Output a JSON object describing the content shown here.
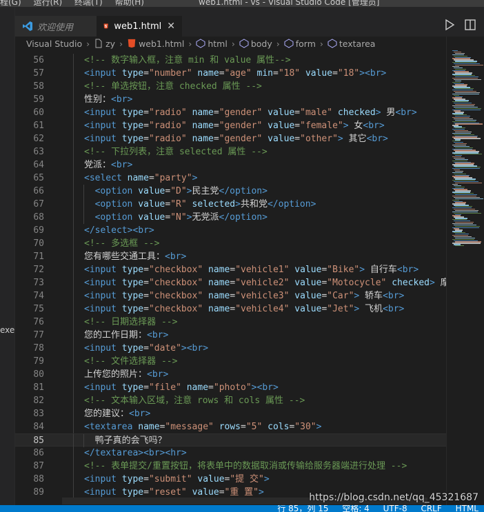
{
  "titlebar": {
    "menu": [
      "程(G)",
      "运行(R)",
      "终端(T)",
      "帮助(H)"
    ],
    "window_title": "web1.html - vs - Visual Studio Code [管理员]"
  },
  "leftpanel": {
    "fragment": "exe"
  },
  "tabs": [
    {
      "label": "欢迎使用",
      "active": false,
      "icon": "vscode-icon"
    },
    {
      "label": "web1.html",
      "active": true,
      "icon": "html5-icon"
    }
  ],
  "breadcrumb": {
    "items": [
      "Visual Studio",
      "zy",
      "web1.html",
      "html",
      "body",
      "form",
      "textarea"
    ]
  },
  "editor": {
    "current_line": 85,
    "lines": [
      {
        "n": 56,
        "indent": 2,
        "tokens": [
          [
            "cmt",
            "<!-- 数字输入框，注意 min 和 value 属性-->"
          ]
        ]
      },
      {
        "n": 57,
        "indent": 2,
        "tokens": [
          [
            "tag",
            "<input "
          ],
          [
            "attr",
            "type"
          ],
          [
            "txt",
            "="
          ],
          [
            "str",
            "\"number\""
          ],
          [
            "txt",
            " "
          ],
          [
            "attr",
            "name"
          ],
          [
            "txt",
            "="
          ],
          [
            "str",
            "\"age\""
          ],
          [
            "txt",
            " "
          ],
          [
            "attr",
            "min"
          ],
          [
            "txt",
            "="
          ],
          [
            "str",
            "\"18\""
          ],
          [
            "txt",
            " "
          ],
          [
            "attr",
            "value"
          ],
          [
            "txt",
            "="
          ],
          [
            "str",
            "\"18\""
          ],
          [
            "tag",
            "><br>"
          ]
        ]
      },
      {
        "n": 58,
        "indent": 2,
        "tokens": [
          [
            "cmt",
            "<!-- 单选按钮，注意 checked 属性 -->"
          ]
        ]
      },
      {
        "n": 59,
        "indent": 2,
        "tokens": [
          [
            "txt",
            "性别："
          ],
          [
            "tag",
            "<br>"
          ]
        ]
      },
      {
        "n": 60,
        "indent": 2,
        "tokens": [
          [
            "tag",
            "<input "
          ],
          [
            "attr",
            "type"
          ],
          [
            "txt",
            "="
          ],
          [
            "str",
            "\"radio\""
          ],
          [
            "txt",
            " "
          ],
          [
            "attr",
            "name"
          ],
          [
            "txt",
            "="
          ],
          [
            "str",
            "\"gender\""
          ],
          [
            "txt",
            " "
          ],
          [
            "attr",
            "value"
          ],
          [
            "txt",
            "="
          ],
          [
            "str",
            "\"male\""
          ],
          [
            "txt",
            " "
          ],
          [
            "attr",
            "checked"
          ],
          [
            "tag",
            ">"
          ],
          [
            "txt",
            " 男"
          ],
          [
            "tag",
            "<br>"
          ]
        ]
      },
      {
        "n": 61,
        "indent": 2,
        "tokens": [
          [
            "tag",
            "<input "
          ],
          [
            "attr",
            "type"
          ],
          [
            "txt",
            "="
          ],
          [
            "str",
            "\"radio\""
          ],
          [
            "txt",
            " "
          ],
          [
            "attr",
            "name"
          ],
          [
            "txt",
            "="
          ],
          [
            "str",
            "\"gender\""
          ],
          [
            "txt",
            " "
          ],
          [
            "attr",
            "value"
          ],
          [
            "txt",
            "="
          ],
          [
            "str",
            "\"female\""
          ],
          [
            "tag",
            ">"
          ],
          [
            "txt",
            " 女"
          ],
          [
            "tag",
            "<br>"
          ]
        ]
      },
      {
        "n": 62,
        "indent": 2,
        "tokens": [
          [
            "tag",
            "<input "
          ],
          [
            "attr",
            "type"
          ],
          [
            "txt",
            "="
          ],
          [
            "str",
            "\"radio\""
          ],
          [
            "txt",
            " "
          ],
          [
            "attr",
            "name"
          ],
          [
            "txt",
            "="
          ],
          [
            "str",
            "\"gender\""
          ],
          [
            "txt",
            " "
          ],
          [
            "attr",
            "value"
          ],
          [
            "txt",
            "="
          ],
          [
            "str",
            "\"other\""
          ],
          [
            "tag",
            ">"
          ],
          [
            "txt",
            " 其它"
          ],
          [
            "tag",
            "<br>"
          ]
        ]
      },
      {
        "n": 63,
        "indent": 2,
        "tokens": [
          [
            "cmt",
            "<!-- 下拉列表，注意 selected 属性 -->"
          ]
        ]
      },
      {
        "n": 64,
        "indent": 2,
        "tokens": [
          [
            "txt",
            "党派："
          ],
          [
            "tag",
            "<br>"
          ]
        ]
      },
      {
        "n": 65,
        "indent": 2,
        "tokens": [
          [
            "tag",
            "<select "
          ],
          [
            "attr",
            "name"
          ],
          [
            "txt",
            "="
          ],
          [
            "str",
            "\"party\""
          ],
          [
            "tag",
            ">"
          ]
        ]
      },
      {
        "n": 66,
        "indent": 3,
        "tokens": [
          [
            "tag",
            "<option "
          ],
          [
            "attr",
            "value"
          ],
          [
            "txt",
            "="
          ],
          [
            "str",
            "\"D\""
          ],
          [
            "tag",
            ">"
          ],
          [
            "txt",
            "民主党"
          ],
          [
            "tag",
            "</option>"
          ]
        ]
      },
      {
        "n": 67,
        "indent": 3,
        "tokens": [
          [
            "tag",
            "<option "
          ],
          [
            "attr",
            "value"
          ],
          [
            "txt",
            "="
          ],
          [
            "str",
            "\"R\""
          ],
          [
            "txt",
            " "
          ],
          [
            "attr",
            "selected"
          ],
          [
            "tag",
            ">"
          ],
          [
            "txt",
            "共和党"
          ],
          [
            "tag",
            "</option>"
          ]
        ]
      },
      {
        "n": 68,
        "indent": 3,
        "tokens": [
          [
            "tag",
            "<option "
          ],
          [
            "attr",
            "value"
          ],
          [
            "txt",
            "="
          ],
          [
            "str",
            "\"N\""
          ],
          [
            "tag",
            ">"
          ],
          [
            "txt",
            "无党派"
          ],
          [
            "tag",
            "</option>"
          ]
        ]
      },
      {
        "n": 69,
        "indent": 2,
        "tokens": [
          [
            "tag",
            "</select><br>"
          ]
        ]
      },
      {
        "n": 70,
        "indent": 2,
        "tokens": [
          [
            "cmt",
            "<!-- 多选框 -->"
          ]
        ]
      },
      {
        "n": 71,
        "indent": 2,
        "tokens": [
          [
            "txt",
            "您有哪些交通工具："
          ],
          [
            "tag",
            "<br>"
          ]
        ]
      },
      {
        "n": 72,
        "indent": 2,
        "tokens": [
          [
            "tag",
            "<input "
          ],
          [
            "attr",
            "type"
          ],
          [
            "txt",
            "="
          ],
          [
            "str",
            "\"checkbox\""
          ],
          [
            "txt",
            " "
          ],
          [
            "attr",
            "name"
          ],
          [
            "txt",
            "="
          ],
          [
            "str",
            "\"vehicle1\""
          ],
          [
            "txt",
            " "
          ],
          [
            "attr",
            "value"
          ],
          [
            "txt",
            "="
          ],
          [
            "str",
            "\"Bike\""
          ],
          [
            "tag",
            ">"
          ],
          [
            "txt",
            " 自行车"
          ],
          [
            "tag",
            "<br>"
          ]
        ]
      },
      {
        "n": 73,
        "indent": 2,
        "tokens": [
          [
            "tag",
            "<input "
          ],
          [
            "attr",
            "type"
          ],
          [
            "txt",
            "="
          ],
          [
            "str",
            "\"checkbox\""
          ],
          [
            "txt",
            " "
          ],
          [
            "attr",
            "name"
          ],
          [
            "txt",
            "="
          ],
          [
            "str",
            "\"vehicle2\""
          ],
          [
            "txt",
            " "
          ],
          [
            "attr",
            "value"
          ],
          [
            "txt",
            "="
          ],
          [
            "str",
            "\"Motocycle\""
          ],
          [
            "txt",
            " "
          ],
          [
            "attr",
            "checked"
          ],
          [
            "tag",
            ">"
          ],
          [
            "txt",
            " 摩托车"
          ]
        ]
      },
      {
        "n": 74,
        "indent": 2,
        "tokens": [
          [
            "tag",
            "<input "
          ],
          [
            "attr",
            "type"
          ],
          [
            "txt",
            "="
          ],
          [
            "str",
            "\"checkbox\""
          ],
          [
            "txt",
            " "
          ],
          [
            "attr",
            "name"
          ],
          [
            "txt",
            "="
          ],
          [
            "str",
            "\"vehicle3\""
          ],
          [
            "txt",
            " "
          ],
          [
            "attr",
            "value"
          ],
          [
            "txt",
            "="
          ],
          [
            "str",
            "\"Car\""
          ],
          [
            "tag",
            ">"
          ],
          [
            "txt",
            " 轿车"
          ],
          [
            "tag",
            "<br>"
          ]
        ]
      },
      {
        "n": 75,
        "indent": 2,
        "tokens": [
          [
            "tag",
            "<input "
          ],
          [
            "attr",
            "type"
          ],
          [
            "txt",
            "="
          ],
          [
            "str",
            "\"checkbox\""
          ],
          [
            "txt",
            " "
          ],
          [
            "attr",
            "name"
          ],
          [
            "txt",
            "="
          ],
          [
            "str",
            "\"vehicle4\""
          ],
          [
            "txt",
            " "
          ],
          [
            "attr",
            "value"
          ],
          [
            "txt",
            "="
          ],
          [
            "str",
            "\"Jet\""
          ],
          [
            "tag",
            ">"
          ],
          [
            "txt",
            " 飞机"
          ],
          [
            "tag",
            "<br>"
          ]
        ]
      },
      {
        "n": 76,
        "indent": 2,
        "tokens": [
          [
            "cmt",
            "<!-- 日期选择器 -->"
          ]
        ]
      },
      {
        "n": 77,
        "indent": 2,
        "tokens": [
          [
            "txt",
            "您的工作日期："
          ],
          [
            "tag",
            "<br>"
          ]
        ]
      },
      {
        "n": 78,
        "indent": 2,
        "tokens": [
          [
            "tag",
            "<input "
          ],
          [
            "attr",
            "type"
          ],
          [
            "txt",
            "="
          ],
          [
            "str",
            "\"date\""
          ],
          [
            "tag",
            "><br>"
          ]
        ]
      },
      {
        "n": 79,
        "indent": 2,
        "tokens": [
          [
            "cmt",
            "<!-- 文件选择器 -->"
          ]
        ]
      },
      {
        "n": 80,
        "indent": 2,
        "tokens": [
          [
            "txt",
            "上传您的照片："
          ],
          [
            "tag",
            "<br>"
          ]
        ]
      },
      {
        "n": 81,
        "indent": 2,
        "tokens": [
          [
            "tag",
            "<input "
          ],
          [
            "attr",
            "type"
          ],
          [
            "txt",
            "="
          ],
          [
            "str",
            "\"file\""
          ],
          [
            "txt",
            " "
          ],
          [
            "attr",
            "name"
          ],
          [
            "txt",
            "="
          ],
          [
            "str",
            "\"photo\""
          ],
          [
            "tag",
            "><br>"
          ]
        ]
      },
      {
        "n": 82,
        "indent": 2,
        "tokens": [
          [
            "cmt",
            "<!-- 文本输入区域，注意 rows 和 cols 属性 -->"
          ]
        ]
      },
      {
        "n": 83,
        "indent": 2,
        "tokens": [
          [
            "txt",
            "您的建议："
          ],
          [
            "tag",
            "<br>"
          ]
        ]
      },
      {
        "n": 84,
        "indent": 2,
        "tokens": [
          [
            "tag",
            "<textarea "
          ],
          [
            "attr",
            "name"
          ],
          [
            "txt",
            "="
          ],
          [
            "str",
            "\"message\""
          ],
          [
            "txt",
            " "
          ],
          [
            "attr",
            "rows"
          ],
          [
            "txt",
            "="
          ],
          [
            "str",
            "\"5\""
          ],
          [
            "txt",
            " "
          ],
          [
            "attr",
            "cols"
          ],
          [
            "txt",
            "="
          ],
          [
            "str",
            "\"30\""
          ],
          [
            "tag",
            ">"
          ]
        ]
      },
      {
        "n": 85,
        "indent": 3,
        "tokens": [
          [
            "txt",
            "鸭子真的会飞吗？"
          ]
        ]
      },
      {
        "n": 86,
        "indent": 2,
        "tokens": [
          [
            "tag",
            "</textarea><br><hr>"
          ]
        ]
      },
      {
        "n": 87,
        "indent": 2,
        "tokens": [
          [
            "cmt",
            "<!-- 表单提交/重置按钮，将表单中的数据取消或传输给服务器端进行处理 -->"
          ]
        ]
      },
      {
        "n": 88,
        "indent": 2,
        "tokens": [
          [
            "tag",
            "<input "
          ],
          [
            "attr",
            "type"
          ],
          [
            "txt",
            "="
          ],
          [
            "str",
            "\"submit\""
          ],
          [
            "txt",
            " "
          ],
          [
            "attr",
            "value"
          ],
          [
            "txt",
            "="
          ],
          [
            "str",
            "\"提 交\""
          ],
          [
            "tag",
            ">"
          ]
        ]
      },
      {
        "n": 89,
        "indent": 2,
        "tokens": [
          [
            "tag",
            "<input "
          ],
          [
            "attr",
            "type"
          ],
          [
            "txt",
            "="
          ],
          [
            "str",
            "\"reset\""
          ],
          [
            "txt",
            " "
          ],
          [
            "attr",
            "value"
          ],
          [
            "txt",
            "="
          ],
          [
            "str",
            "\"重 置\""
          ],
          [
            "tag",
            ">"
          ]
        ]
      }
    ]
  },
  "watermark": "https://blog.csdn.net/qq_45321687",
  "statusbar": [
    "行 85，列 15",
    "空格: 4",
    "UTF-8",
    "CRLF",
    "HTML"
  ],
  "colors": {
    "tag": "#569cd6",
    "attr": "#9cdcfe",
    "string": "#ce9178",
    "comment": "#6a9955",
    "text": "#d4d4d4",
    "statusbar": "#007acc"
  }
}
